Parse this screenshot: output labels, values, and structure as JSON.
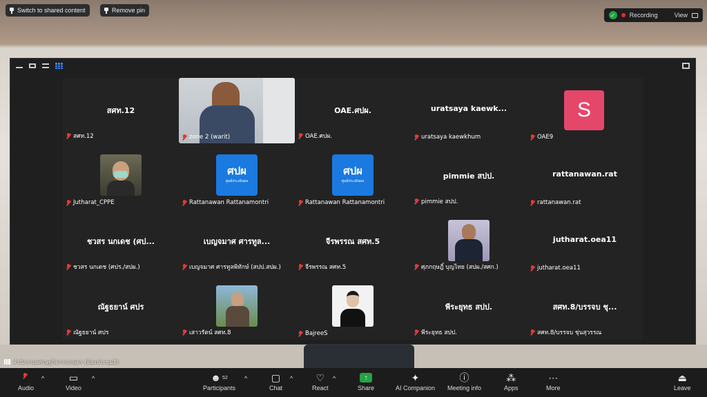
{
  "top": {
    "switch_label": "Switch to shared content",
    "remove_pin_label": "Remove pin",
    "recording_label": "Recording",
    "view_label": "View"
  },
  "tiles": [
    {
      "big": "สศท.12",
      "label": "สศท.12",
      "kind": "name"
    },
    {
      "big": "",
      "label": "zone 2 (warit)",
      "kind": "video"
    },
    {
      "big": "OAE.ศปผ.",
      "label": "OAE.ศปผ.",
      "kind": "name"
    },
    {
      "big": "uratsaya kaewk...",
      "label": "uratsaya kaewkhum",
      "kind": "name"
    },
    {
      "big": "S",
      "label": "OAE9",
      "kind": "avatar"
    },
    {
      "big": "",
      "label": "Jutharat_CPPE",
      "kind": "photo"
    },
    {
      "big": "ศปผ",
      "label": "Rattanawan Rattanamontri",
      "kind": "logo"
    },
    {
      "big": "ศปผ",
      "label": "Rattanawan Rattanamontri",
      "kind": "logo"
    },
    {
      "big": "pimmie สปป.",
      "label": "pimmie สปป.",
      "kind": "name"
    },
    {
      "big": "rattanawan.rat",
      "label": "rattanawan.rat",
      "kind": "name"
    },
    {
      "big": "ชวสร นกเดช (ศป...",
      "label": "ชวสร นกเดช (ศปร./สปผ.)",
      "kind": "name"
    },
    {
      "big": "เบญจมาศ ศารทูล...",
      "label": "เบญจมาศ ศารทูลพิทักษ์ (สปป.สปผ.)",
      "kind": "name"
    },
    {
      "big": "จีรพรรณ สศท.5",
      "label": "จีรพรรณ สศท.5",
      "kind": "name"
    },
    {
      "big": "",
      "label": "ศุภกฤษฎิ์ บุญไทย (สปผ./สศก.)",
      "kind": "photo"
    },
    {
      "big": "jutharat.oea11",
      "label": "jutharat.oea11",
      "kind": "name"
    },
    {
      "big": "ณัฐธยาน์ ศปร",
      "label": "ณัฐธยาน์ ศปร",
      "kind": "name"
    },
    {
      "big": "",
      "label": "เสาวรัตน์ สศท.8",
      "kind": "photo"
    },
    {
      "big": "",
      "label": "BajreeS",
      "kind": "photo"
    },
    {
      "big": "พีระยุทธ สปป.",
      "label": "พีระยุทธ สปป.",
      "kind": "name"
    },
    {
      "big": "สศท.8/บรรจบ ชุ...",
      "label": "สศท.8/บรรจบ ชุ่นสุวรรณ",
      "kind": "name"
    }
  ],
  "logo_sub": "ศูนย์ประเมินผล",
  "strip": {
    "room_label": "สำนักงานเศรษฐกิจการเกษตร (ห้องประชุม1)"
  },
  "toolbar": {
    "audio": "Audio",
    "video": "Video",
    "participants": "Participants",
    "participants_count": "52",
    "chat": "Chat",
    "react": "React",
    "share": "Share",
    "ai": "AI Companion",
    "meeting_info": "Meeting info",
    "apps": "Apps",
    "more": "More",
    "leave": "Leave"
  },
  "colors": {
    "avatar": "#e5476a",
    "logo": "#1a7ae0",
    "share": "#25a244",
    "rec": "#e02b2b"
  }
}
